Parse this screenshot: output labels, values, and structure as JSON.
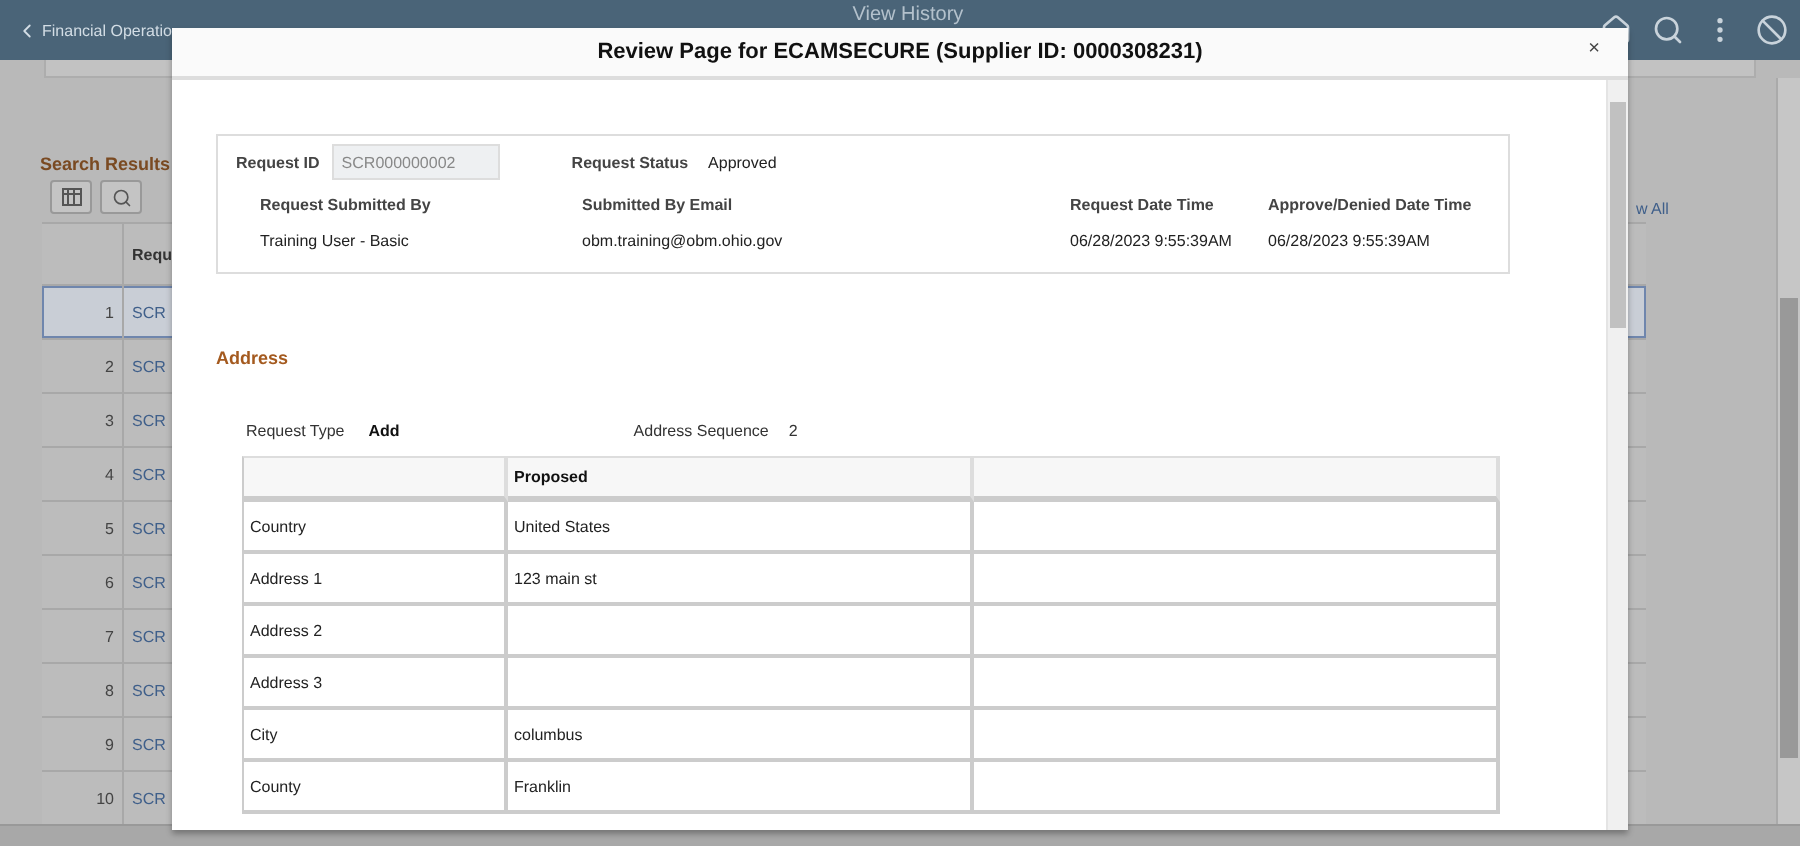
{
  "header": {
    "back_label": "Financial Operatio",
    "title": "View History"
  },
  "search_results": {
    "title": "Search Results",
    "view_all": "w All",
    "column": "Requ",
    "rows": [
      {
        "number": "1",
        "link": "SCR",
        "selected": true
      },
      {
        "number": "2",
        "link": "SCR",
        "selected": false
      },
      {
        "number": "3",
        "link": "SCR",
        "selected": false
      },
      {
        "number": "4",
        "link": "SCR",
        "selected": false
      },
      {
        "number": "5",
        "link": "SCR",
        "selected": false
      },
      {
        "number": "6",
        "link": "SCR",
        "selected": false
      },
      {
        "number": "7",
        "link": "SCR",
        "selected": false
      },
      {
        "number": "8",
        "link": "SCR",
        "selected": false
      },
      {
        "number": "9",
        "link": "SCR",
        "selected": false
      },
      {
        "number": "10",
        "link": "SCR",
        "selected": false
      }
    ]
  },
  "dialog": {
    "title": "Review Page for ECAMSECURE (Supplier ID: 0000308231)",
    "close": "×",
    "summary": {
      "request_id_label": "Request ID",
      "request_id": "SCR000000002",
      "status_label": "Request Status",
      "status": "Approved",
      "fields": [
        {
          "label": "Request Submitted By",
          "value": "Training User - Basic"
        },
        {
          "label": "Submitted By Email",
          "value": "obm.training@obm.ohio.gov"
        },
        {
          "label": "Request Date Time",
          "value": "06/28/2023  9:55:39AM"
        },
        {
          "label": "Approve/Denied Date Time",
          "value": "06/28/2023  9:55:39AM"
        }
      ]
    },
    "section_title": "Address",
    "request_type_label": "Request Type",
    "request_type": "Add",
    "sequence_label": "Address Sequence",
    "sequence": "2",
    "table": {
      "proposed_heading": "Proposed",
      "rows": [
        {
          "label": "Country",
          "proposed": "United States"
        },
        {
          "label": "Address 1",
          "proposed": "123 main st"
        },
        {
          "label": "Address 2"
        },
        {
          "label": "Address 3"
        },
        {
          "label": "City",
          "proposed": "columbus"
        },
        {
          "label": "County",
          "proposed": "Franklin"
        }
      ]
    }
  }
}
